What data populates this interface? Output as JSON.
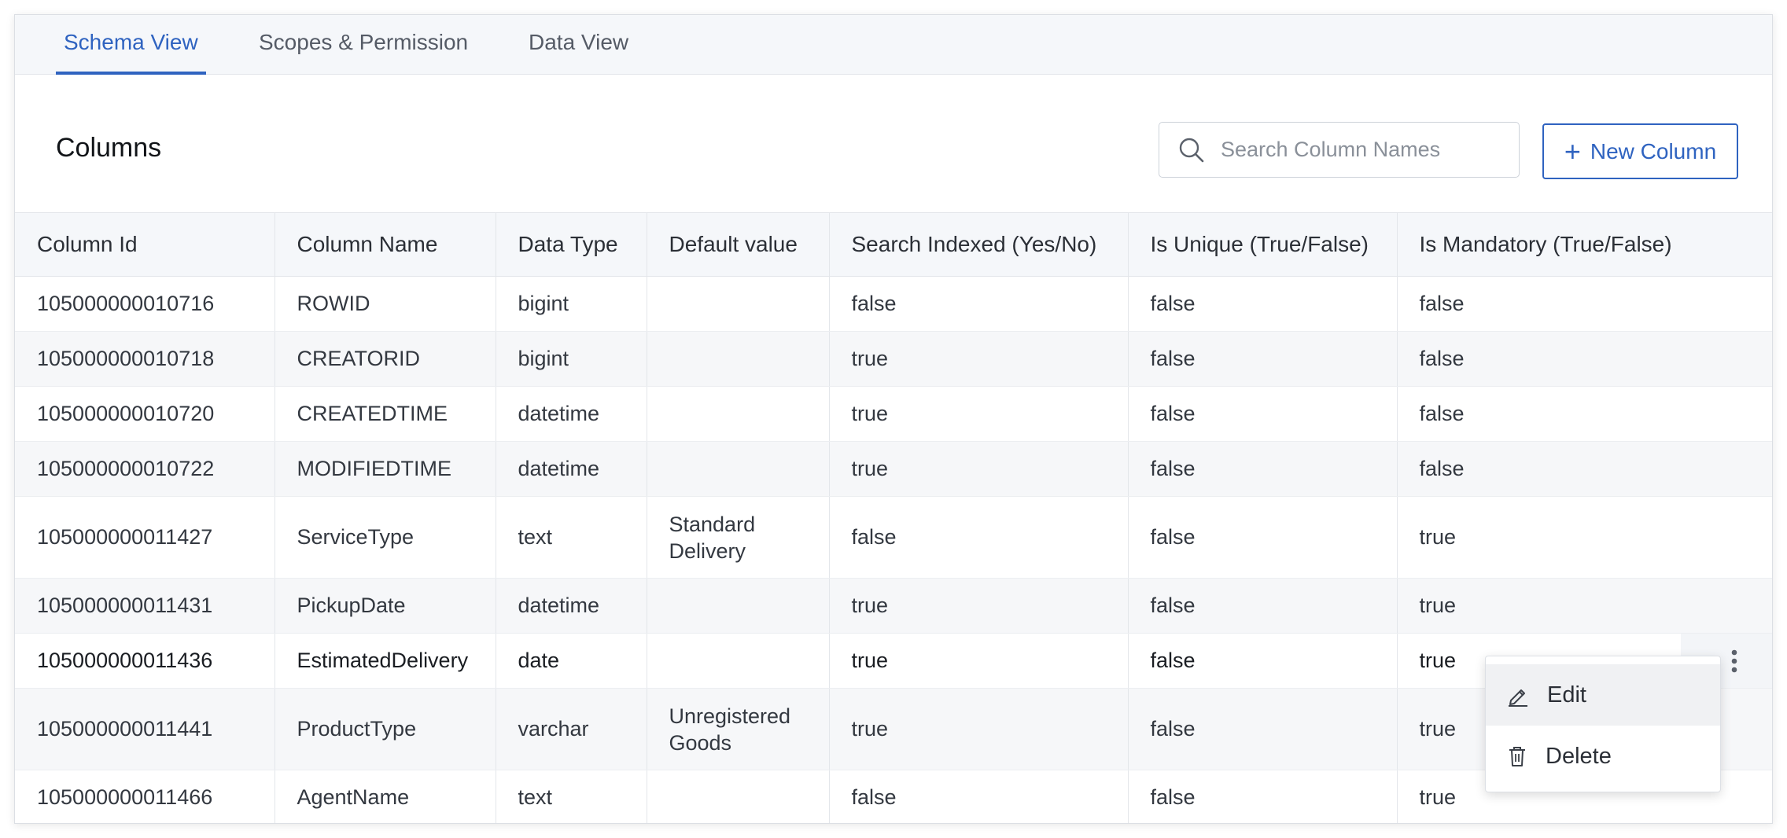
{
  "tabs": [
    {
      "label": "Schema View",
      "active": true
    },
    {
      "label": "Scopes & Permission",
      "active": false
    },
    {
      "label": "Data View",
      "active": false
    }
  ],
  "section_title": "Columns",
  "search": {
    "placeholder": "Search Column Names",
    "value": ""
  },
  "new_column_button": {
    "label": "New Column",
    "icon": "plus-icon"
  },
  "table": {
    "headers": [
      "Column Id",
      "Column Name",
      "Data Type",
      "Default value",
      "Search Indexed (Yes/No)",
      "Is Unique (True/False)",
      "Is Mandatory (True/False)"
    ],
    "rows": [
      [
        "105000000010716",
        "ROWID",
        "bigint",
        "",
        "false",
        "false",
        "false"
      ],
      [
        "105000000010718",
        "CREATORID",
        "bigint",
        "",
        "true",
        "false",
        "false"
      ],
      [
        "105000000010720",
        "CREATEDTIME",
        "datetime",
        "",
        "true",
        "false",
        "false"
      ],
      [
        "105000000010722",
        "MODIFIEDTIME",
        "datetime",
        "",
        "true",
        "false",
        "false"
      ],
      [
        "105000000011427",
        "ServiceType",
        "text",
        "Standard Delivery",
        "false",
        "false",
        "true"
      ],
      [
        "105000000011431",
        "PickupDate",
        "datetime",
        "",
        "true",
        "false",
        "true"
      ],
      [
        "105000000011436",
        "EstimatedDelivery",
        "date",
        "",
        "true",
        "false",
        "true"
      ],
      [
        "105000000011441",
        "ProductType",
        "varchar",
        "Unregistered Goods",
        "true",
        "false",
        "true"
      ],
      [
        "105000000011466",
        "AgentName",
        "text",
        "",
        "false",
        "false",
        "true"
      ]
    ]
  },
  "row_menu": {
    "items": [
      {
        "label": "Edit",
        "icon": "pencil-icon"
      },
      {
        "label": "Delete",
        "icon": "trash-icon"
      }
    ]
  },
  "colors": {
    "accent": "#2f63c0",
    "header_bg": "#f5f7fa",
    "zebra_bg": "#f6f7f9",
    "border": "#e3e6ea"
  }
}
